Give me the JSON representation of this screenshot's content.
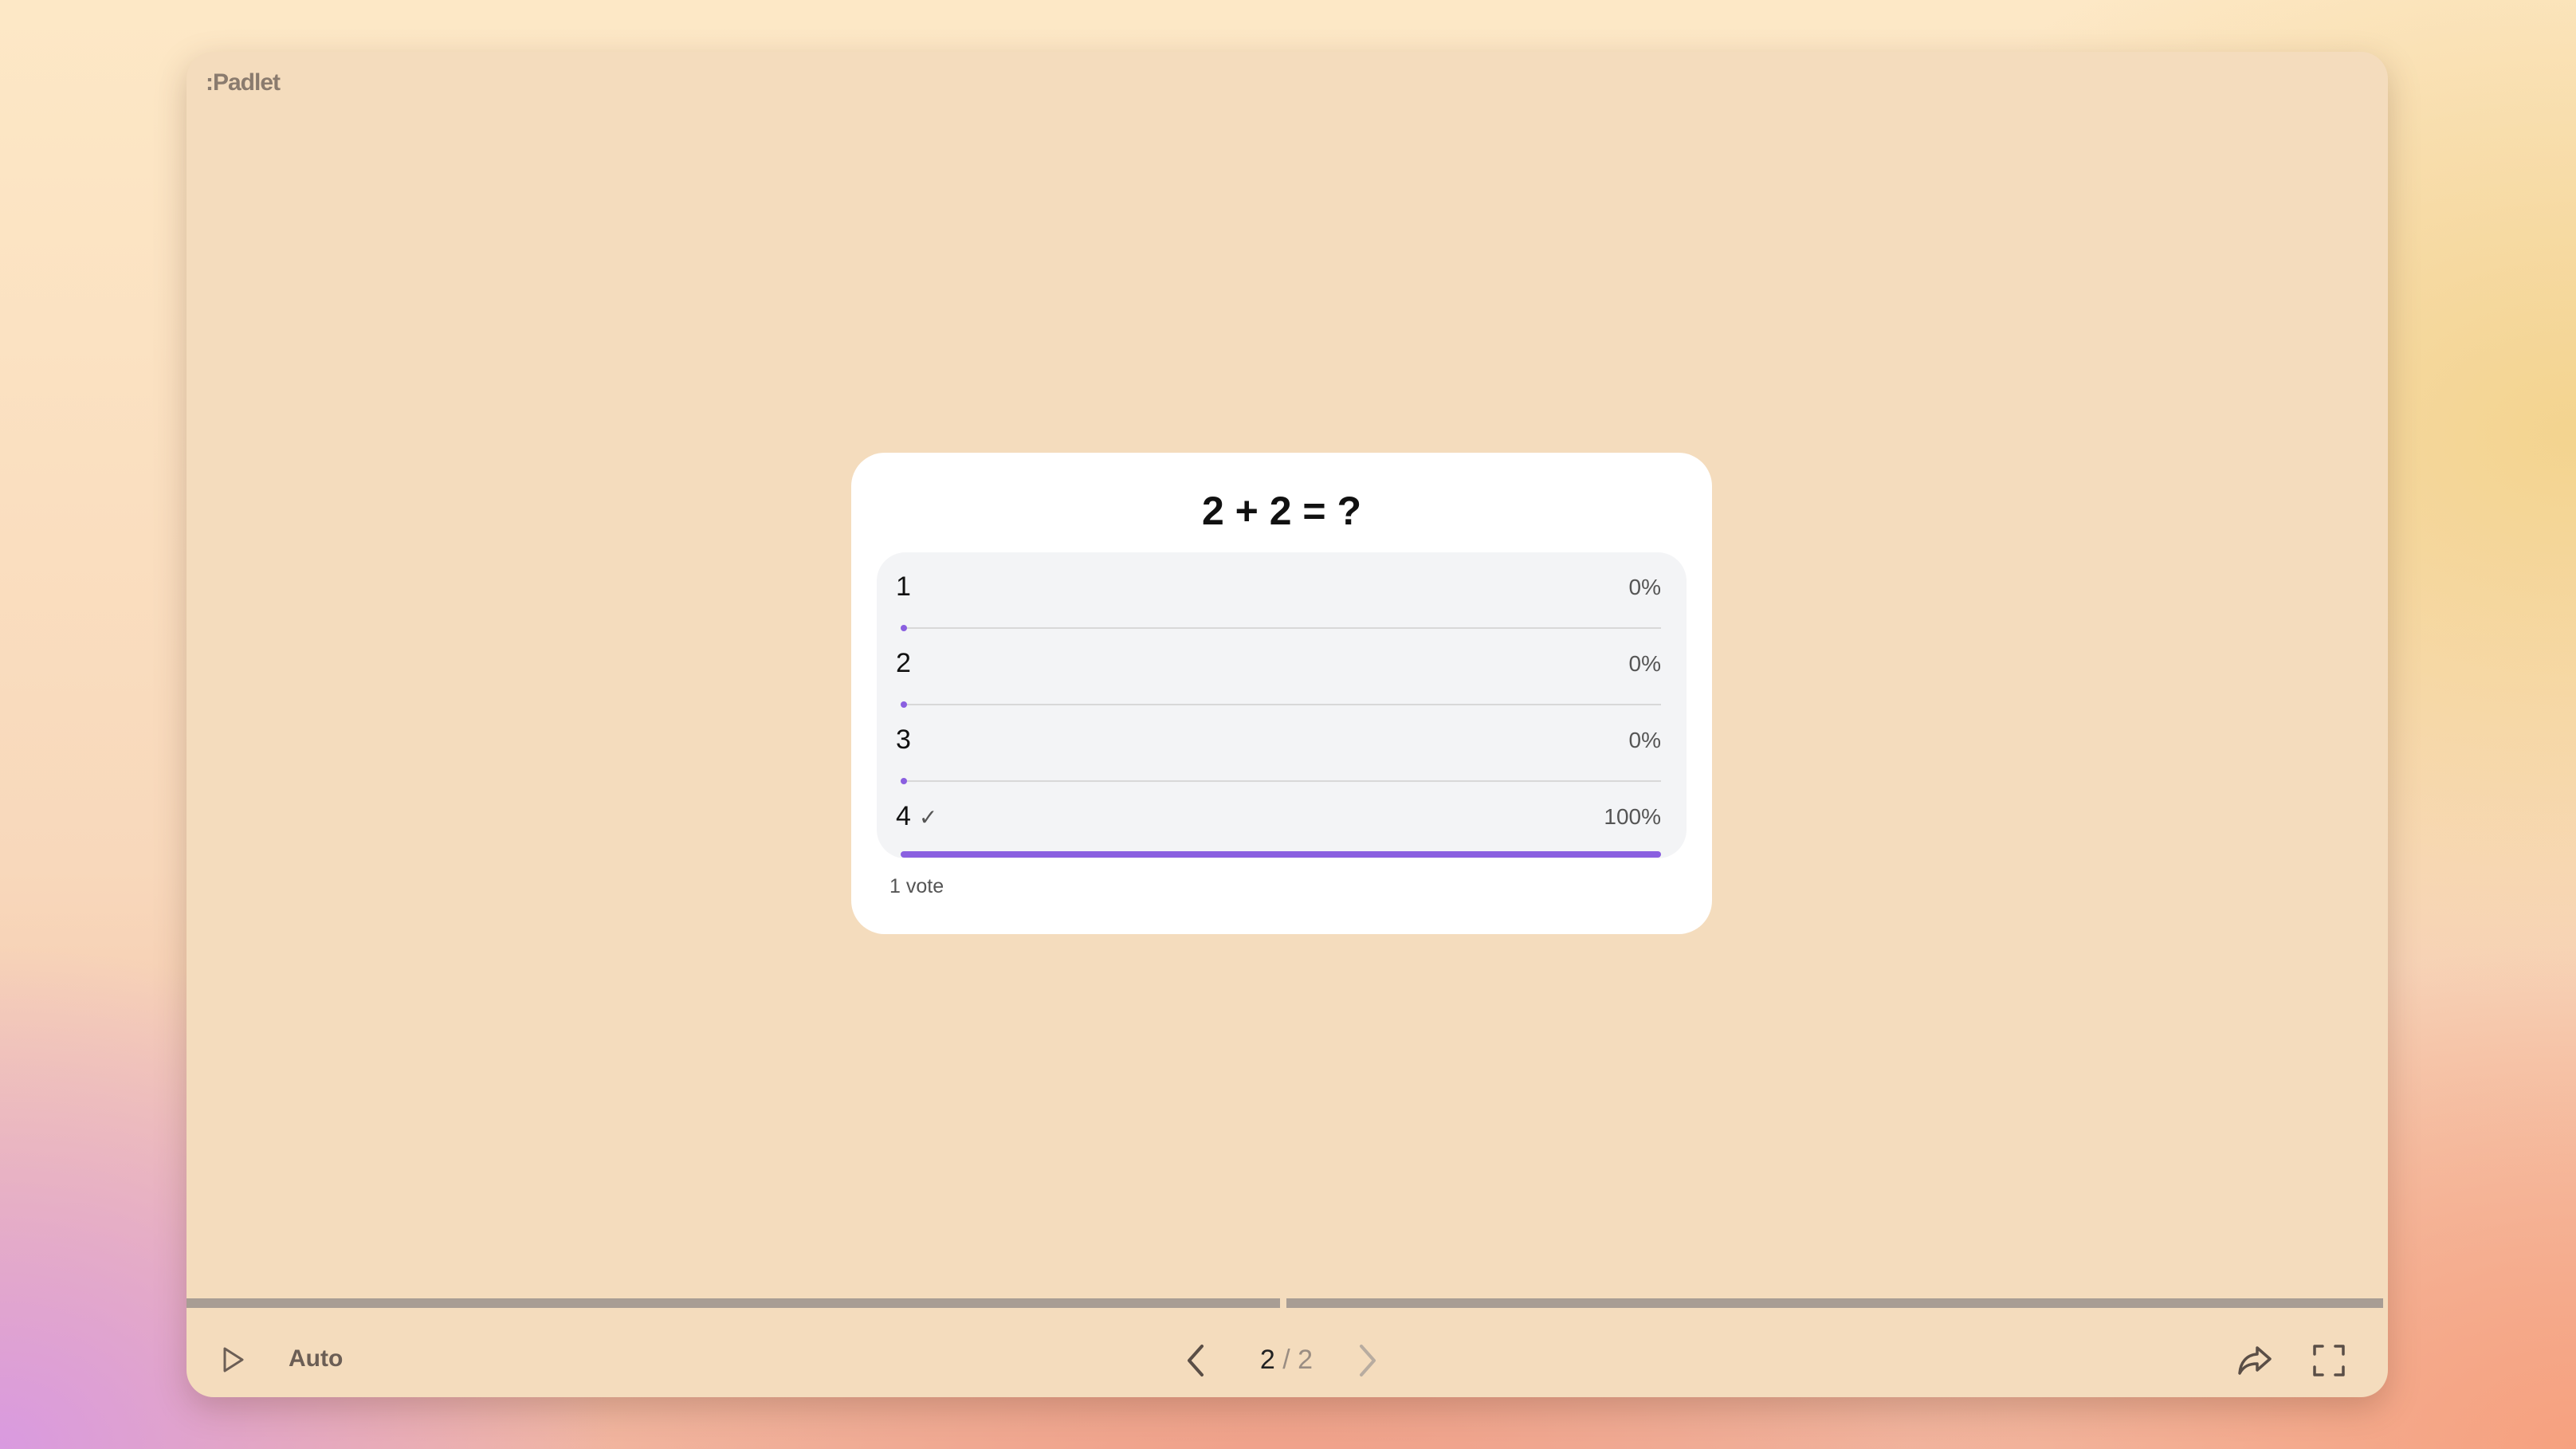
{
  "app": {
    "logo": ":Padlet"
  },
  "poll": {
    "question": "2 + 2 = ?",
    "options": [
      {
        "label": "1",
        "percent_text": "0%",
        "fraction": 0.0,
        "correct": false
      },
      {
        "label": "2",
        "percent_text": "0%",
        "fraction": 0.0,
        "correct": false
      },
      {
        "label": "3",
        "percent_text": "0%",
        "fraction": 0.0,
        "correct": false
      },
      {
        "label": "4",
        "percent_text": "100%",
        "fraction": 1.0,
        "correct": true
      }
    ],
    "votes": "1 vote",
    "accent_color": "#8a5fe0"
  },
  "slideshow": {
    "slides_progress": [
      1.0,
      1.0
    ],
    "mode_label": "Auto",
    "current_page": "2",
    "separator": " / ",
    "total_pages": "2"
  },
  "icons": {
    "play": "play-icon",
    "prev": "chevron-left-icon",
    "next": "chevron-right-icon",
    "share": "share-icon",
    "fullscreen": "fullscreen-icon",
    "check": "check-icon"
  }
}
